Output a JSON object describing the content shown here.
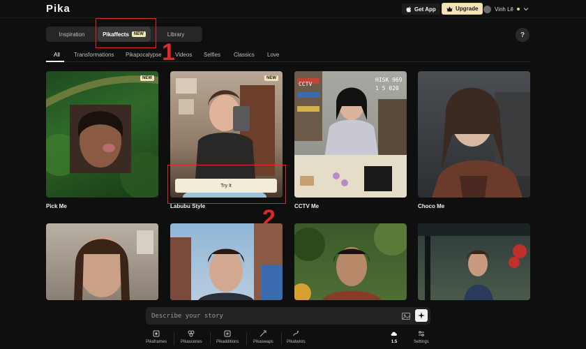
{
  "app": {
    "logo": "Pika"
  },
  "topbar": {
    "get_app_label": "Get App",
    "upgrade_label": "Upgrade",
    "user_name": "Vinh Lê"
  },
  "segments": [
    {
      "label": "Inspiration"
    },
    {
      "label": "Pikaffects",
      "badge": "NEW"
    },
    {
      "label": "Library"
    }
  ],
  "help_label": "?",
  "filters": [
    "All",
    "Transformations",
    "Pikapocalypse",
    "Videos",
    "Selfies",
    "Classics",
    "Love"
  ],
  "annotations": {
    "one": "1",
    "two": "2"
  },
  "cards": [
    {
      "title": "Pick Me",
      "badge": "NEW"
    },
    {
      "title": "Labubu Style",
      "badge": "NEW",
      "try_label": "Try It"
    },
    {
      "title": "CCTV Me",
      "overlay": "HISK 969",
      "overlay2": "1 5 020"
    },
    {
      "title": "Choco Me"
    }
  ],
  "prompt": {
    "placeholder": "Describe your story"
  },
  "bottom_nav": [
    {
      "label": "Pikaframes",
      "icon": "frames-icon"
    },
    {
      "label": "Pikascenes",
      "icon": "scenes-icon"
    },
    {
      "label": "Pikadditions",
      "icon": "additions-icon"
    },
    {
      "label": "Pikaswaps",
      "icon": "swaps-icon"
    },
    {
      "label": "Pikatwists",
      "icon": "twists-icon"
    },
    {
      "label": "1.5",
      "icon": "cloud-icon"
    },
    {
      "label": "Settings",
      "icon": "settings-icon"
    }
  ]
}
